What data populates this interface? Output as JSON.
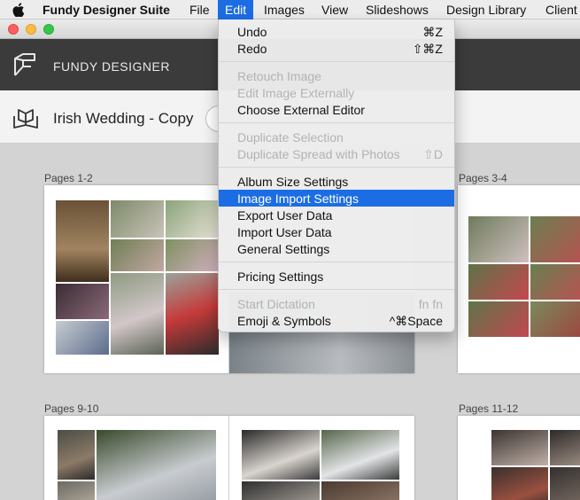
{
  "menubar": {
    "app_name": "Fundy Designer Suite",
    "items": [
      "File",
      "Edit",
      "Images",
      "View",
      "Slideshows",
      "Design Library",
      "Client"
    ],
    "active_index": 1
  },
  "header": {
    "brand": "FUNDY DESIGNER"
  },
  "project": {
    "title": "Irish Wedding - Copy"
  },
  "spreads": [
    {
      "label": "Pages 1-2"
    },
    {
      "label": "Pages 3-4"
    },
    {
      "label": "Pages 9-10"
    },
    {
      "label": "Pages 11-12"
    }
  ],
  "edit_menu": {
    "undo": {
      "label": "Undo",
      "shortcut": "⌘Z"
    },
    "redo": {
      "label": "Redo",
      "shortcut": "⇧⌘Z"
    },
    "retouch": {
      "label": "Retouch Image"
    },
    "edit_external": {
      "label": "Edit Image Externally"
    },
    "choose_editor": {
      "label": "Choose External Editor"
    },
    "duplicate_selection": {
      "label": "Duplicate Selection"
    },
    "duplicate_spread": {
      "label": "Duplicate Spread with Photos",
      "shortcut": "⇧D"
    },
    "album_size": {
      "label": "Album Size Settings"
    },
    "image_import": {
      "label": "Image Import Settings"
    },
    "export_user": {
      "label": "Export User Data"
    },
    "import_user": {
      "label": "Import User Data"
    },
    "general": {
      "label": "General Settings"
    },
    "pricing": {
      "label": "Pricing Settings"
    },
    "dictation": {
      "label": "Start Dictation",
      "shortcut": "fn fn"
    },
    "emoji": {
      "label": "Emoji & Symbols",
      "shortcut": "^⌘Space"
    }
  },
  "colors": {
    "highlight": "#1c6de4",
    "header_bg": "#3b3b3b"
  }
}
